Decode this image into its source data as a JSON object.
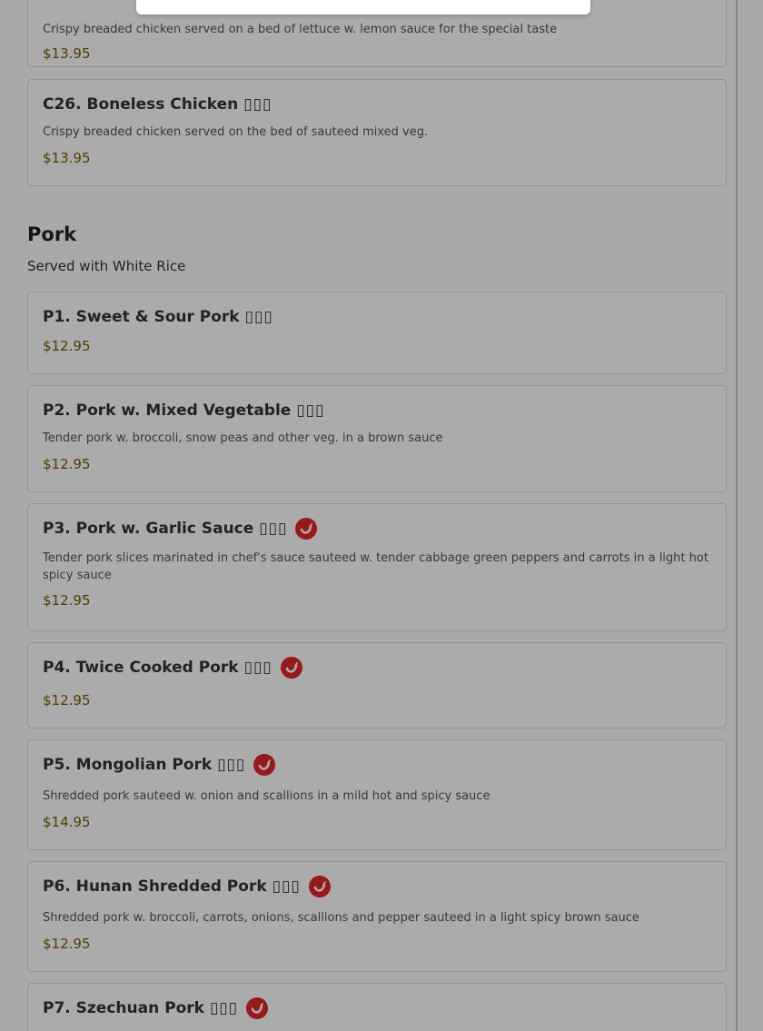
{
  "items_top": [
    {
      "desc": "Crispy breaded chicken served on a bed of lettuce w. lemon sauce for the special taste",
      "price": "$13.95"
    },
    {
      "title": "C26. Boneless Chicken",
      "zh": "▯▯▯",
      "desc": "Crispy breaded chicken served on the bed of sauteed mixed veg.",
      "price": "$13.95"
    }
  ],
  "section": {
    "title": "Pork",
    "subtitle": "Served with White Rice"
  },
  "items": [
    {
      "title": "P1. Sweet & Sour Pork",
      "zh": "▯▯▯",
      "desc": "",
      "price": "$12.95",
      "spicy": false
    },
    {
      "title": "P2. Pork w. Mixed Vegetable",
      "zh": "▯▯▯",
      "desc": "Tender pork w. broccoli, snow peas and other veg. in a brown sauce",
      "price": "$12.95",
      "spicy": false
    },
    {
      "title": "P3. Pork w. Garlic Sauce",
      "zh": "▯▯▯",
      "desc": "Tender pork slices marinated in chef's sauce sauteed w. tender cabbage green peppers and carrots in a light hot spicy sauce",
      "price": "$12.95",
      "spicy": true
    },
    {
      "title": "P4. Twice Cooked Pork",
      "zh": "▯▯▯",
      "desc": "",
      "price": "$12.95",
      "spicy": true
    },
    {
      "title": "P5. Mongolian Pork",
      "zh": "▯▯▯",
      "desc": "Shredded pork sauteed w. onion and scallions in a mild hot and spicy sauce",
      "price": "$14.95",
      "spicy": true
    },
    {
      "title": "P6. Hunan Shredded Pork",
      "zh": "▯▯▯",
      "desc": "Shredded pork w. broccoli, carrots, onions, scallions and pepper sauteed in a light spicy brown sauce",
      "price": "$12.95",
      "spicy": true
    },
    {
      "title": "P7. Szechuan Pork",
      "zh": "▯▯▯",
      "desc": "",
      "price": "",
      "spicy": true
    }
  ],
  "icons": {
    "spicy": "chili-pepper-icon"
  },
  "colors": {
    "price": "#7a5a00",
    "spicy_badge": "#e0262a",
    "overlay": "rgba(0,0,0,0.33)"
  }
}
